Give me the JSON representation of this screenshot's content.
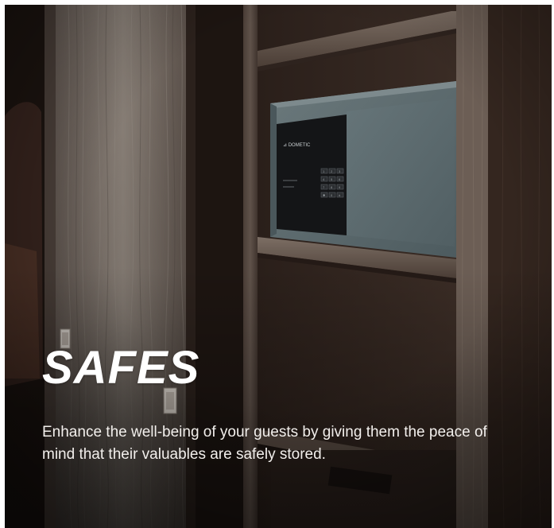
{
  "hero": {
    "heading": "SAFES",
    "description": "Enhance the well-being of your guests by giving them the peace of mind that their valuables are safely stored.",
    "safe_brand": "DOMETIC",
    "keypad_keys": [
      "1",
      "2",
      "3",
      "4",
      "5",
      "6",
      "7",
      "8",
      "9",
      "✱",
      "0",
      "#"
    ]
  },
  "colors": {
    "wood_dark": "#2a1d18",
    "wood_light": "#8c8077",
    "safe_body": "#5c6a6e",
    "text": "#ffffff"
  }
}
